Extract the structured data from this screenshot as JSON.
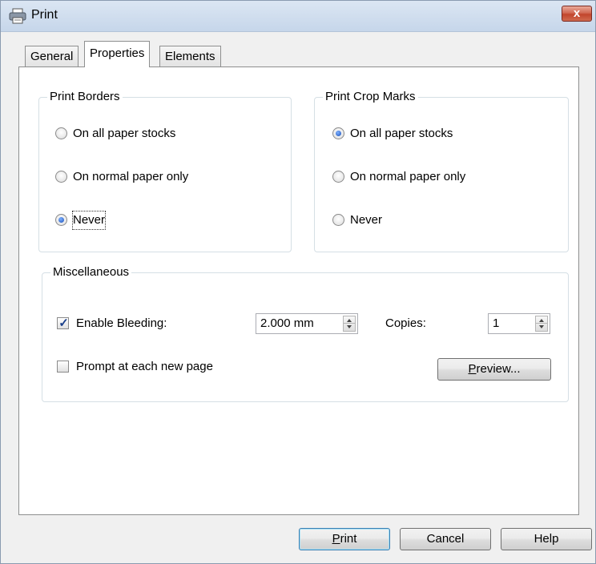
{
  "window": {
    "title": "Print",
    "close_glyph": "x",
    "icon": "printer-icon"
  },
  "tabs": [
    {
      "label": "General",
      "active": false
    },
    {
      "label": "Properties",
      "active": true
    },
    {
      "label": "Elements",
      "active": false
    }
  ],
  "print_borders": {
    "label": "Print Borders",
    "options": [
      {
        "label": "On all paper stocks",
        "checked": false
      },
      {
        "label": "On normal paper only",
        "checked": false
      },
      {
        "label": "Never",
        "checked": true
      }
    ]
  },
  "print_crop_marks": {
    "label": "Print Crop Marks",
    "options": [
      {
        "label": "On all paper stocks",
        "checked": true
      },
      {
        "label": "On normal paper only",
        "checked": false
      },
      {
        "label": "Never",
        "checked": false
      }
    ]
  },
  "misc": {
    "label": "Miscellaneous",
    "enable_bleeding": {
      "label": "Enable Bleeding:",
      "checked": true,
      "value": "2.000 mm"
    },
    "copies": {
      "label": "Copies:",
      "value": "1"
    },
    "prompt": {
      "label": "Prompt at each new page",
      "checked": false
    },
    "preview_button": {
      "mnemonic": "P",
      "rest": "review..."
    }
  },
  "footer": {
    "print_button": {
      "mnemonic": "P",
      "rest": "rint"
    },
    "cancel_button": "Cancel",
    "help_button": "Help"
  },
  "colors": {
    "accent": "#1b4fb8",
    "close": "#c2452c"
  }
}
